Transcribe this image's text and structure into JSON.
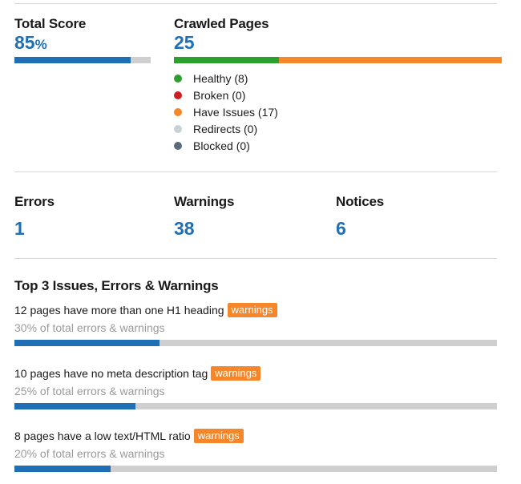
{
  "colors": {
    "accent": "#1f6fb5",
    "track": "#cfcfcf",
    "healthy": "#2ca02c",
    "broken": "#cc1f1f",
    "issues": "#f5862a",
    "redirects": "#c8d1d3",
    "blocked": "#5a6b7c",
    "badge": "#f5862a"
  },
  "total_score": {
    "label": "Total Score",
    "value": "85",
    "unit": "%",
    "progress": 0.85
  },
  "crawled": {
    "label": "Crawled Pages",
    "value": "25",
    "segments": [
      {
        "key": "healthy",
        "count": 8
      },
      {
        "key": "issues",
        "count": 17
      }
    ],
    "legend": [
      {
        "label": "Healthy (8)",
        "color": "#2ca02c"
      },
      {
        "label": "Broken (0)",
        "color": "#cc1f1f"
      },
      {
        "label": "Have Issues (17)",
        "color": "#f5862a"
      },
      {
        "label": "Redirects (0)",
        "color": "#c8d1d3"
      },
      {
        "label": "Blocked (0)",
        "color": "#5a6b7c"
      }
    ]
  },
  "stats": {
    "errors": {
      "label": "Errors",
      "value": "1"
    },
    "warnings": {
      "label": "Warnings",
      "value": "38"
    },
    "notices": {
      "label": "Notices",
      "value": "6"
    }
  },
  "top_issues": {
    "title": "Top 3 Issues, Errors & Warnings",
    "items": [
      {
        "text": "12 pages have more than one H1 heading",
        "badge": "warnings",
        "share": "30% of total errors & warnings",
        "fraction": 0.3
      },
      {
        "text": "10 pages have no meta description tag",
        "badge": "warnings",
        "share": "25% of total errors & warnings",
        "fraction": 0.25
      },
      {
        "text": "8 pages have a low text/HTML ratio",
        "badge": "warnings",
        "share": "20% of total errors & warnings",
        "fraction": 0.2
      }
    ]
  }
}
